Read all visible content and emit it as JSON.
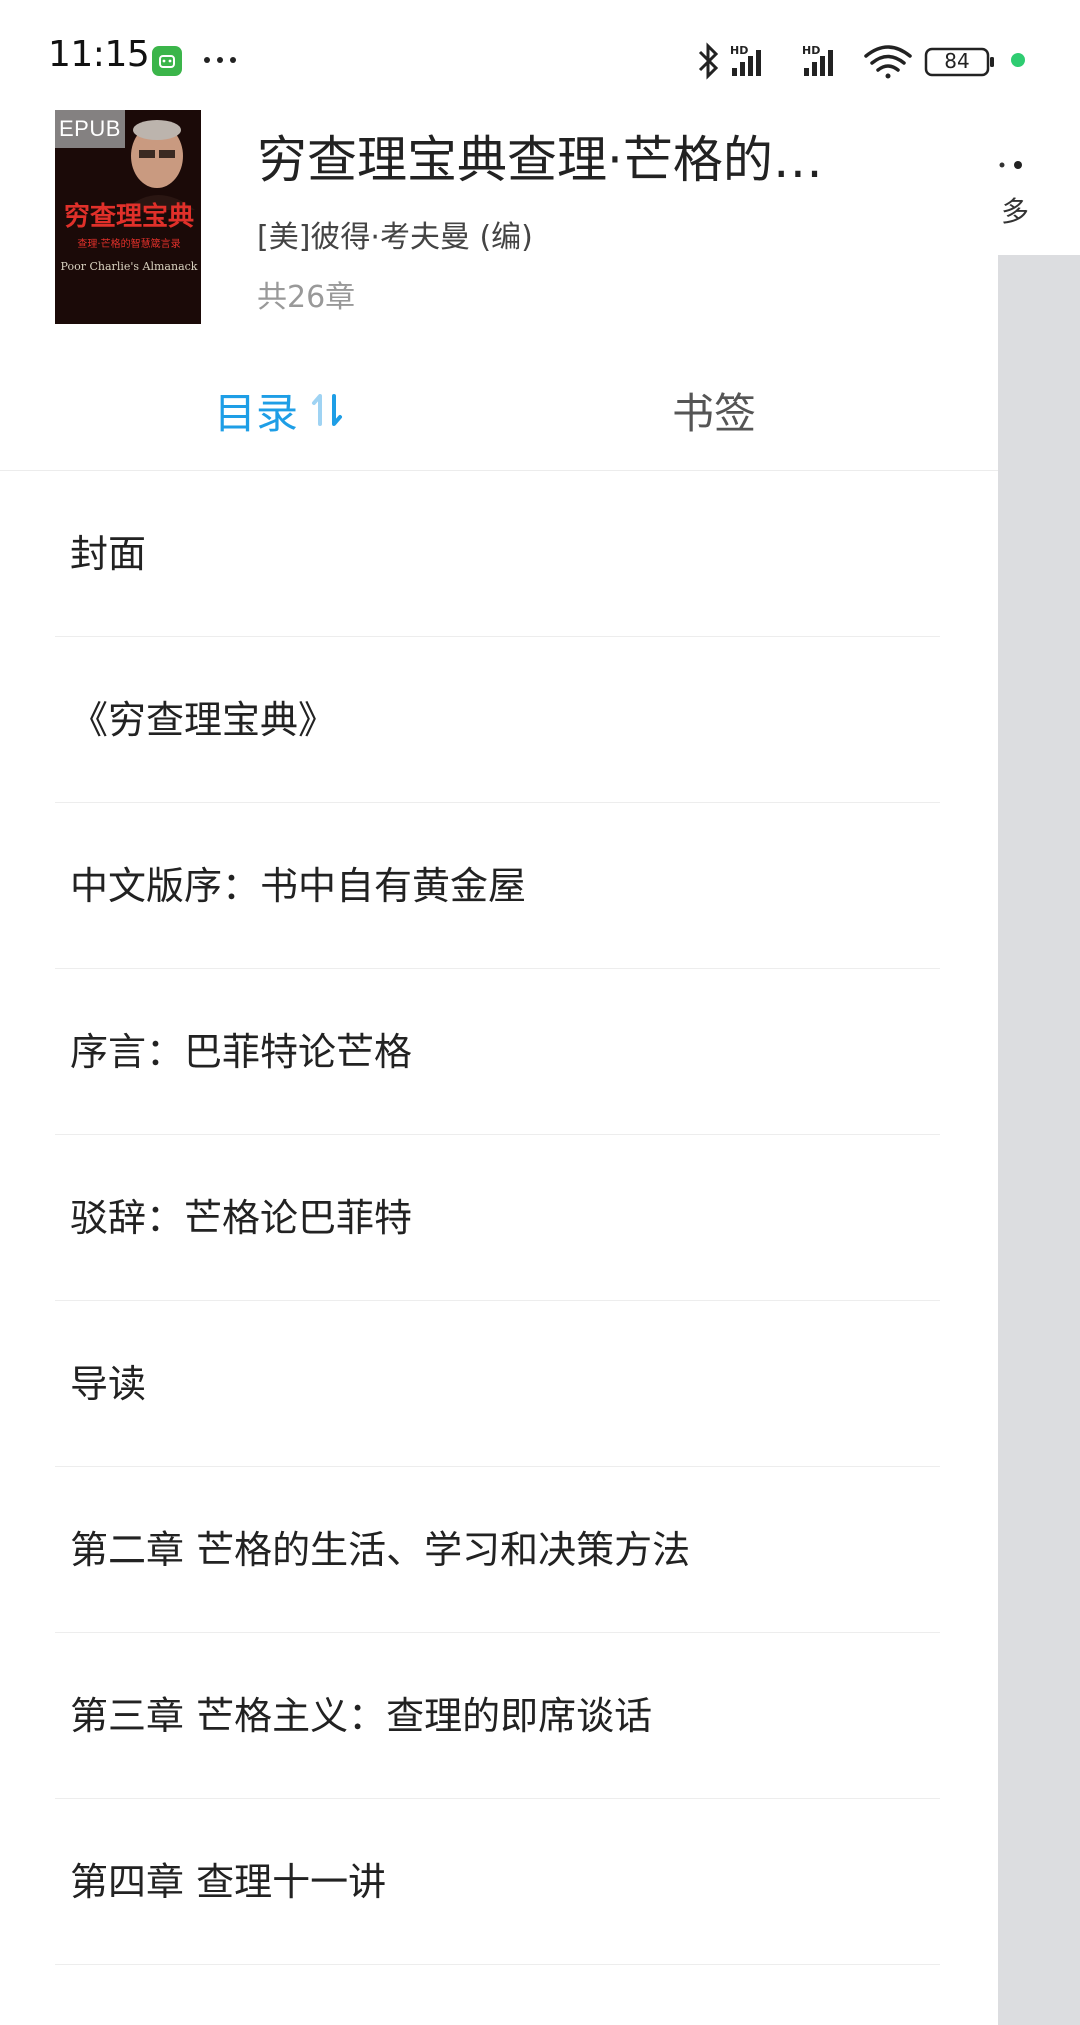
{
  "status_bar": {
    "time": "11:15",
    "dots": "···",
    "battery": "84",
    "icons": [
      "app-notification-icon",
      "bluetooth-icon",
      "hd-signal-icon",
      "hd-signal-icon",
      "wifi-icon",
      "battery-icon",
      "green-dot-icon"
    ]
  },
  "book": {
    "badge": "EPUB",
    "cover_title": "穷查理宝典",
    "cover_subtitle": "查理·芒格的智慧箴言录",
    "cover_english": "Poor Charlie's Almanack",
    "title": "穷查理宝典查理·芒格的…",
    "author": "[美]彼得·考夫曼 (编)",
    "chapter_count": "共26章"
  },
  "tabs": {
    "toc": "目录",
    "bookmarks": "书签"
  },
  "toc_items": [
    "封面",
    "《穷查理宝典》",
    "中文版序：书中自有黄金屋",
    "序言：巴菲特论芒格",
    "驳辞：芒格论巴菲特",
    "导读",
    "第二章 芒格的生活、学习和决策方法",
    "第三章 芒格主义：查理的即席谈话",
    "第四章 查理十一讲"
  ],
  "peek": {
    "text": "多"
  },
  "colors": {
    "accent": "#1e9ee6",
    "peek_gray": "#dcdde0"
  }
}
